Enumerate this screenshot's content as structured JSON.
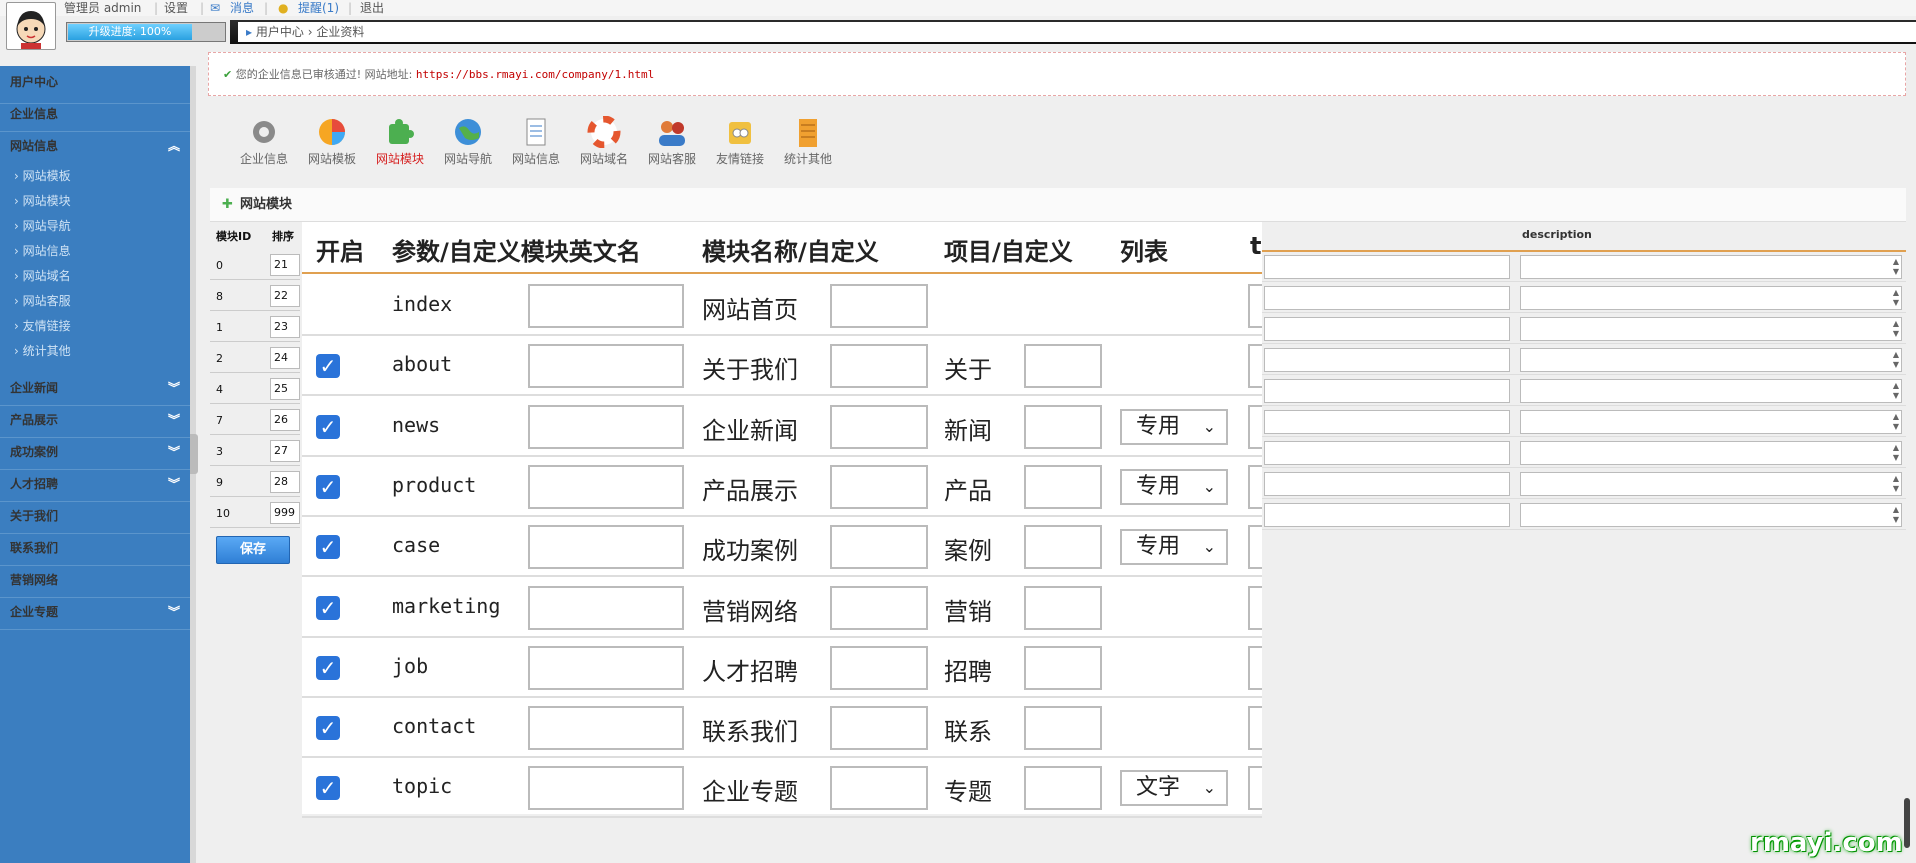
{
  "topbar": {
    "admin": "管理员 admin",
    "settings": "设置",
    "messages": "消息",
    "reminders": "提醒(1)",
    "logout": "退出"
  },
  "progress": {
    "label": "升级进度: 100%",
    "value": 100
  },
  "breadcrumb": {
    "item1": "用户中心",
    "item2": "企业资料"
  },
  "sidebar": {
    "user_center": "用户中心",
    "company_info": "企业信息",
    "website_info": "网站信息",
    "subitems": [
      "网站模板",
      "网站模块",
      "网站导航",
      "网站信息",
      "网站域名",
      "网站客服",
      "友情链接",
      "统计其他"
    ],
    "sections": [
      "企业新闻",
      "产品展示",
      "成功案例",
      "人才招聘",
      "关于我们",
      "联系我们",
      "营销网络",
      "企业专题"
    ]
  },
  "notice": {
    "text": "您的企业信息已审核通过! 网站地址:",
    "url": "https://bbs.rmayi.com/company/1.html"
  },
  "toolbar": {
    "items": [
      "企业信息",
      "网站模板",
      "网站模块",
      "网站导航",
      "网站信息",
      "网站域名",
      "网站客服",
      "友情链接",
      "统计其他"
    ]
  },
  "panel": {
    "title": "网站模块"
  },
  "left_table": {
    "col_id": "模块ID",
    "col_order": "排序",
    "rows": [
      {
        "id": "0",
        "order": "21"
      },
      {
        "id": "8",
        "order": "22"
      },
      {
        "id": "1",
        "order": "23"
      },
      {
        "id": "2",
        "order": "24"
      },
      {
        "id": "4",
        "order": "25"
      },
      {
        "id": "7",
        "order": "26"
      },
      {
        "id": "3",
        "order": "27"
      },
      {
        "id": "9",
        "order": "28"
      },
      {
        "id": "10",
        "order": "999"
      }
    ],
    "save_label": "保存"
  },
  "overlay": {
    "headers": {
      "enable": "开启",
      "param": "参数/自定义模块英文名",
      "name": "模块名称/自定义",
      "item": "项目/自定义",
      "list": "列表",
      "cut": "t"
    },
    "rows": [
      {
        "slug": "index",
        "name": "网站首页",
        "item": "",
        "list": "",
        "checked": false
      },
      {
        "slug": "about",
        "name": "关于我们",
        "item": "关于",
        "list": "",
        "checked": true
      },
      {
        "slug": "news",
        "name": "企业新闻",
        "item": "新闻",
        "list": "专用",
        "checked": true
      },
      {
        "slug": "product",
        "name": "产品展示",
        "item": "产品",
        "list": "专用",
        "checked": true
      },
      {
        "slug": "case",
        "name": "成功案例",
        "item": "案例",
        "list": "专用",
        "checked": true
      },
      {
        "slug": "marketing",
        "name": "营销网络",
        "item": "营销",
        "list": "",
        "checked": true
      },
      {
        "slug": "job",
        "name": "人才招聘",
        "item": "招聘",
        "list": "",
        "checked": true
      },
      {
        "slug": "contact",
        "name": "联系我们",
        "item": "联系",
        "list": "",
        "checked": true
      },
      {
        "slug": "topic",
        "name": "企业专题",
        "item": "专题",
        "list": "文字",
        "checked": true
      }
    ]
  },
  "right_table": {
    "description_header": "description"
  },
  "watermark": "rmayi.com"
}
